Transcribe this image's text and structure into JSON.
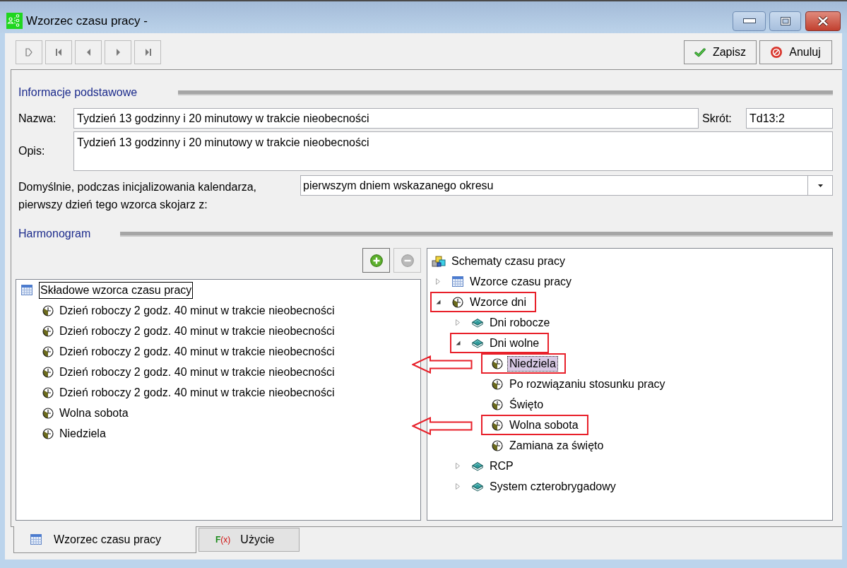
{
  "window": {
    "title": "Wzorzec czasu pracy -"
  },
  "toolbar": {
    "nav_buttons": [
      {
        "kind": "new",
        "disabled": true
      },
      {
        "kind": "first",
        "disabled": true
      },
      {
        "kind": "previous",
        "disabled": true
      },
      {
        "kind": "next",
        "disabled": true
      },
      {
        "kind": "last",
        "disabled": true
      }
    ],
    "actions": [
      {
        "kind": "save",
        "label": "Zapisz"
      },
      {
        "kind": "cancel",
        "label": "Anuluj"
      }
    ]
  },
  "basic_info": {
    "heading": "Informacje podstawowe",
    "name": {
      "label": "Nazwa:",
      "value": "Tydzień 13 godzinny i 20 minutowy w trakcie nieobecności"
    },
    "short_name": {
      "label": "Skrót:",
      "value": "Td13:2"
    },
    "description": {
      "label": "Opis:",
      "value": "Tydzień 13 godzinny i 20 minutowy w trakcie nieobecności"
    },
    "start_day": {
      "label": "Domyślnie, podczas inicjalizowania kalendarza, pierwszy dzień tego wzorca skojarz z:",
      "value": "pierwszym dniem wskazanego okresu"
    }
  },
  "schedule": {
    "heading": "Harmonogram",
    "buttons": [
      {
        "kind": "add",
        "disabled": false
      },
      {
        "kind": "remove",
        "disabled": true
      }
    ],
    "components": {
      "label": "Składowe wzorca czasu pracy",
      "kind": "work_pattern",
      "focused": true,
      "children": [
        {
          "label": "Dzień roboczy 2 godz. 40 minut w trakcie nieobecności",
          "kind": "day_pattern",
          "focused": false
        },
        {
          "label": "Dzień roboczy 2 godz. 40 minut w trakcie nieobecności",
          "kind": "day_pattern",
          "focused": false
        },
        {
          "label": "Dzień roboczy 2 godz. 40 minut w trakcie nieobecności",
          "kind": "day_pattern",
          "focused": false
        },
        {
          "label": "Dzień roboczy 2 godz. 40 minut w trakcie nieobecności",
          "kind": "day_pattern",
          "focused": false
        },
        {
          "label": "Dzień roboczy 2 godz. 40 minut w trakcie nieobecności",
          "kind": "day_pattern",
          "focused": false
        },
        {
          "label": "Wolna sobota",
          "kind": "day_pattern",
          "focused": false
        },
        {
          "label": "Niedziela",
          "kind": "day_pattern",
          "focused": false
        }
      ]
    },
    "catalog": {
      "label": "Schematy czasu pracy",
      "kind": "schema",
      "selected": false,
      "annotated": false,
      "arrow": false,
      "children": [
        {
          "label": "Wzorce czasu pracy",
          "kind": "work_pattern",
          "expanded": false,
          "selected": false,
          "annotated": false,
          "arrow": false
        },
        {
          "label": "Wzorce dni",
          "kind": "day_pattern",
          "expanded": true,
          "selected": false,
          "annotated": true,
          "arrow": false,
          "children": [
            {
              "label": "Dni robocze",
              "kind": "group",
              "expanded": false,
              "selected": false,
              "annotated": false,
              "arrow": false
            },
            {
              "label": "Dni wolne",
              "kind": "group",
              "expanded": true,
              "selected": false,
              "annotated": true,
              "arrow": false,
              "children": [
                {
                  "label": "Niedziela",
                  "kind": "day_pattern",
                  "selected": true,
                  "annotated": true,
                  "arrow": true
                },
                {
                  "label": "Po rozwiązaniu stosunku pracy",
                  "kind": "day_pattern",
                  "selected": false,
                  "annotated": false,
                  "arrow": false
                },
                {
                  "label": "Święto",
                  "kind": "day_pattern",
                  "selected": false,
                  "annotated": false,
                  "arrow": false
                },
                {
                  "label": "Wolna sobota",
                  "kind": "day_pattern",
                  "selected": false,
                  "annotated": true,
                  "arrow": true
                },
                {
                  "label": "Zamiana za święto",
                  "kind": "day_pattern",
                  "selected": false,
                  "annotated": false,
                  "arrow": false
                }
              ]
            },
            {
              "label": "RCP",
              "kind": "group",
              "expanded": false,
              "selected": false,
              "annotated": false,
              "arrow": false
            },
            {
              "label": "System czterobrygadowy",
              "kind": "group",
              "expanded": false,
              "selected": false,
              "annotated": false,
              "arrow": false
            }
          ]
        }
      ]
    }
  },
  "tabs": [
    {
      "kind": "pattern",
      "label": "Wzorzec czasu pracy",
      "selected": true
    },
    {
      "kind": "usage",
      "symbol": "F(x)",
      "label": "Użycie",
      "selected": false
    }
  ]
}
